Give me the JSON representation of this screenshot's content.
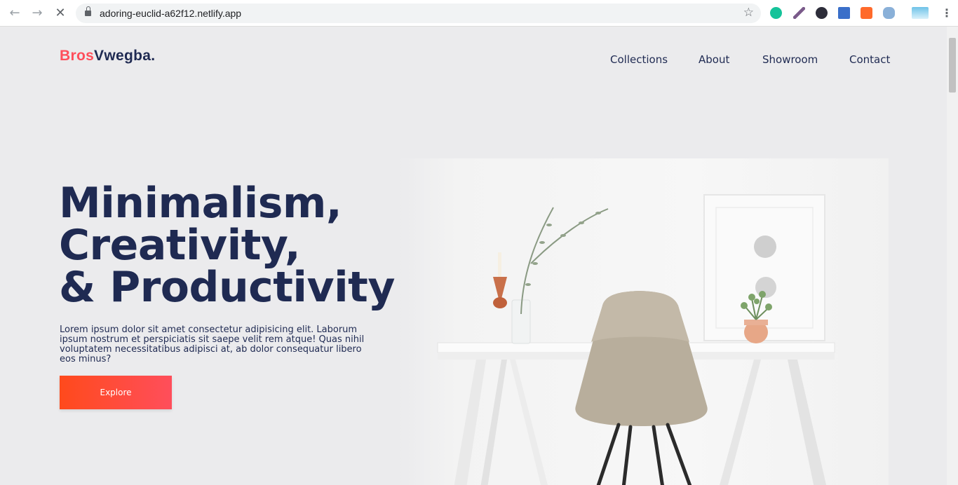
{
  "browser": {
    "url": "adoring-euclid-a62f12.netlify.app"
  },
  "site": {
    "logo_part1": "Bros",
    "logo_part2": "Vwegba."
  },
  "nav": {
    "items": [
      {
        "label": "Collections"
      },
      {
        "label": "About"
      },
      {
        "label": "Showroom"
      },
      {
        "label": "Contact"
      }
    ]
  },
  "hero": {
    "title_line1": "Minimalism,",
    "title_line2": "Creativity,",
    "title_line3": "& Productivity",
    "description": "Lorem ipsum dolor sit amet consectetur adipisicing elit. Laborum ipsum nostrum et perspiciatis sit saepe velit rem atque! Quas nihil voluptatem necessitatibus adipisci at, ab dolor consequatur libero eos minus?",
    "cta_label": "Explore"
  },
  "colors": {
    "brand_red": "#ff4e5b",
    "navy": "#1f2a52",
    "cta_gradient_start": "#ff4a1c",
    "cta_gradient_end": "#ff4e5b",
    "page_bg": "#ebebed"
  }
}
